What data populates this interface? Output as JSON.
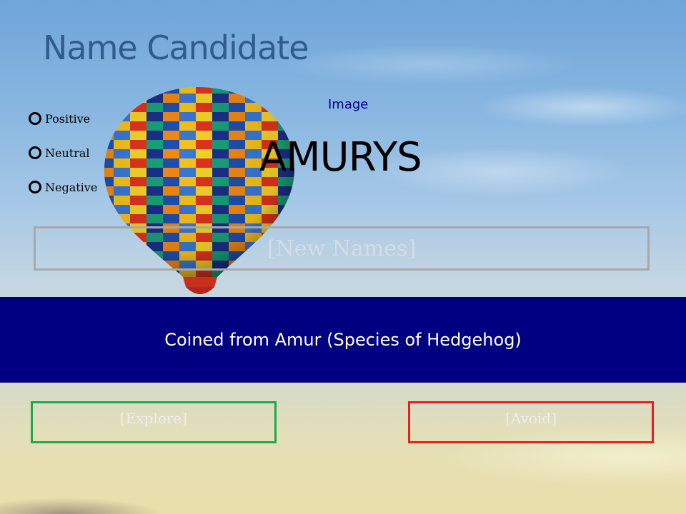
{
  "header": {
    "title": "Name Candidate"
  },
  "sentiment": {
    "options": [
      {
        "label": "Positive"
      },
      {
        "label": "Neutral"
      },
      {
        "label": "Negative"
      }
    ]
  },
  "image_label": "Image",
  "candidate": {
    "name": "AMURYS"
  },
  "new_names": {
    "placeholder": "[New Names]"
  },
  "origin": {
    "text": "Coined from Amur (Species of Hedgehog)"
  },
  "actions": {
    "explore": "[Explore]",
    "avoid": "[Avoid]"
  },
  "icons": {
    "radio": "radio-circle-icon",
    "background": "hot-air-balloon-photo"
  },
  "colors": {
    "title": "#2f5b8f",
    "band": "#000080",
    "image_label": "#00008b",
    "explore_border": "#1faa4a",
    "avoid_border": "#ee1c1c",
    "new_names_border": "#a8a8a8"
  }
}
